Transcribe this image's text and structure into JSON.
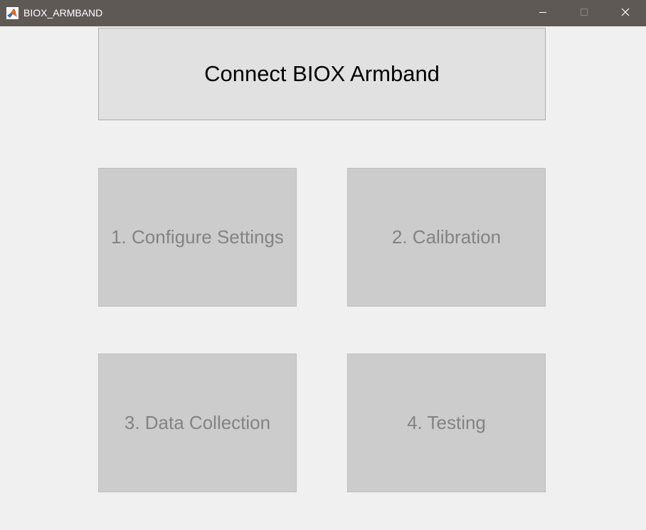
{
  "window": {
    "title": "BIOX_ARMBAND",
    "icon": "matlab-icon",
    "controls": {
      "minimize_icon": "minimize-icon",
      "maximize_icon": "maximize-icon",
      "close_icon": "close-icon"
    }
  },
  "main": {
    "connect_label": "Connect BIOX Armband",
    "steps": [
      {
        "label": "1. Configure Settings",
        "enabled": false
      },
      {
        "label": "2. Calibration",
        "enabled": false
      },
      {
        "label": "3. Data Collection",
        "enabled": false
      },
      {
        "label": "4. Testing",
        "enabled": false
      }
    ]
  },
  "colors": {
    "titlebar": "#5f5955",
    "background": "#f0f0f0",
    "connect_button": "#e1e1e1",
    "disabled_button": "#cccccc",
    "disabled_text": "#838383"
  }
}
